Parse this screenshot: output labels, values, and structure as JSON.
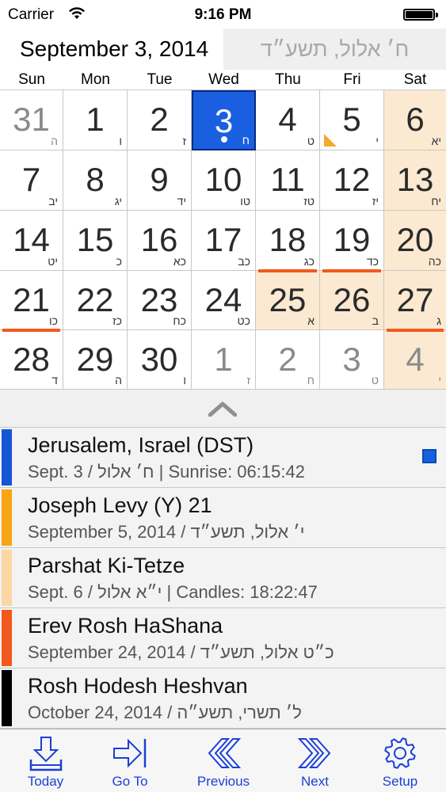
{
  "status_bar": {
    "carrier": "Carrier",
    "time": "9:16 PM"
  },
  "header": {
    "gregorian_date": "September 3, 2014",
    "hebrew_date": "ח׳ אלול, תשע״ד"
  },
  "weekdays": [
    "Sun",
    "Mon",
    "Tue",
    "Wed",
    "Thu",
    "Fri",
    "Sat"
  ],
  "calendar": {
    "weeks": [
      [
        {
          "num": "31",
          "heb": "ה",
          "dim": true
        },
        {
          "num": "1",
          "heb": "ו"
        },
        {
          "num": "2",
          "heb": "ז"
        },
        {
          "num": "3",
          "heb": "ח",
          "today": true,
          "dot": true
        },
        {
          "num": "4",
          "heb": "ט"
        },
        {
          "num": "5",
          "heb": "י",
          "tri": true
        },
        {
          "num": "6",
          "heb": "יא",
          "shade": true
        }
      ],
      [
        {
          "num": "7",
          "heb": "יב"
        },
        {
          "num": "8",
          "heb": "יג"
        },
        {
          "num": "9",
          "heb": "יד"
        },
        {
          "num": "10",
          "heb": "טו"
        },
        {
          "num": "11",
          "heb": "טז"
        },
        {
          "num": "12",
          "heb": "יז"
        },
        {
          "num": "13",
          "heb": "יח",
          "shade": true
        }
      ],
      [
        {
          "num": "14",
          "heb": "יט"
        },
        {
          "num": "15",
          "heb": "כ"
        },
        {
          "num": "16",
          "heb": "כא"
        },
        {
          "num": "17",
          "heb": "כב"
        },
        {
          "num": "18",
          "heb": "כג",
          "bar": true
        },
        {
          "num": "19",
          "heb": "כד",
          "bar": true
        },
        {
          "num": "20",
          "heb": "כה",
          "shade": true
        }
      ],
      [
        {
          "num": "21",
          "heb": "כו",
          "bar": true
        },
        {
          "num": "22",
          "heb": "כז"
        },
        {
          "num": "23",
          "heb": "כח"
        },
        {
          "num": "24",
          "heb": "כט"
        },
        {
          "num": "25",
          "heb": "א",
          "shade": true
        },
        {
          "num": "26",
          "heb": "ב",
          "shade": true
        },
        {
          "num": "27",
          "heb": "ג",
          "shade": true,
          "bar": true
        }
      ],
      [
        {
          "num": "28",
          "heb": "ד"
        },
        {
          "num": "29",
          "heb": "ה"
        },
        {
          "num": "30",
          "heb": "ו"
        },
        {
          "num": "1",
          "heb": "ז",
          "dim": true
        },
        {
          "num": "2",
          "heb": "ח",
          "dim": true
        },
        {
          "num": "3",
          "heb": "ט",
          "dim": true
        },
        {
          "num": "4",
          "heb": "י",
          "dim": true,
          "shade": true
        }
      ]
    ]
  },
  "events": [
    {
      "title": "Jerusalem, Israel (DST)",
      "subtitle": "Sept. 3 / ח׳ אלול | Sunrise: 06:15:42",
      "color": "#1556d6",
      "checkbox": true
    },
    {
      "title": "Joseph Levy (Y) 21",
      "subtitle": "September 5, 2014 / י׳ אלול, תשע״ד",
      "color": "#f7a513"
    },
    {
      "title": "Parshat Ki-Tetze",
      "subtitle": "Sept. 6 / י״א אלול | Candles: 18:22:47",
      "color": "#fcd7a4"
    },
    {
      "title": "Erev Rosh HaShana",
      "subtitle": "September 24, 2014 / כ״ט אלול, תשע״ד",
      "color": "#f2581b"
    },
    {
      "title": "Rosh Hodesh Heshvan",
      "subtitle": "October 24, 2014 / ל׳ תשרי, תשע״ה",
      "color": "#000000"
    }
  ],
  "toolbar": {
    "today": "Today",
    "goto": "Go To",
    "previous": "Previous",
    "next": "Next",
    "setup": "Setup"
  },
  "colors": {
    "accent": "#1a3fd8",
    "today_cell": "#1a5fe0",
    "shabbat_shade": "#fbe9d1",
    "event_bar": "#f25a1a"
  }
}
